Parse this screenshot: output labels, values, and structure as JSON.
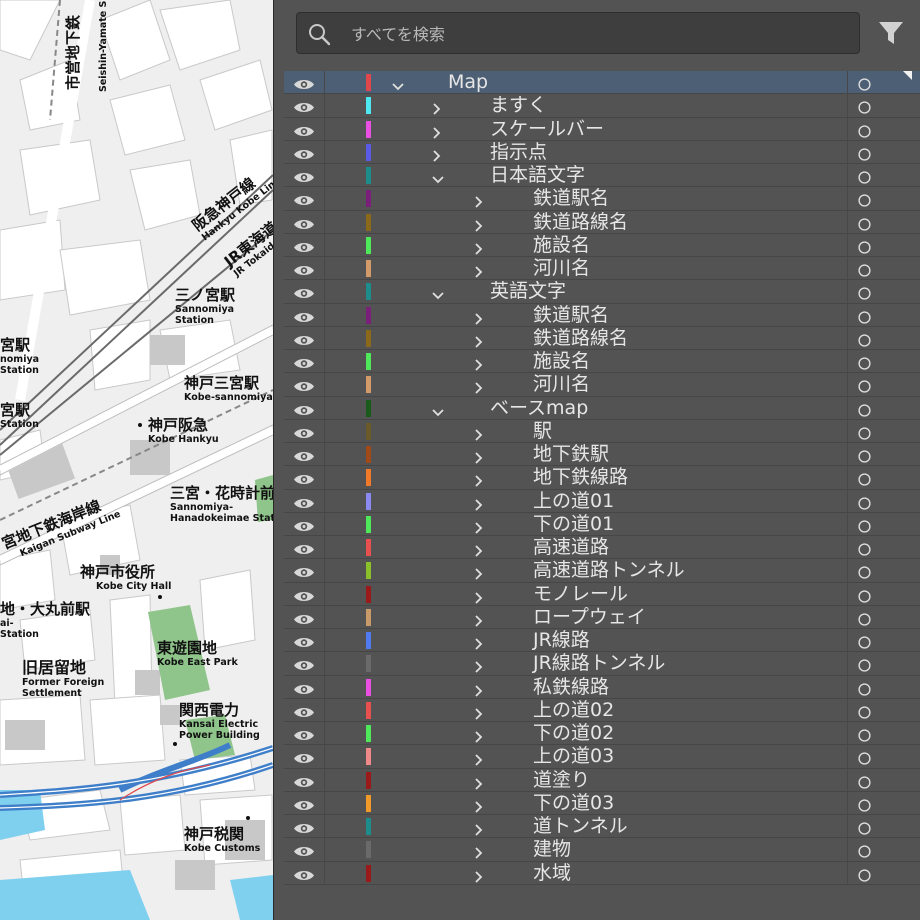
{
  "map": {
    "labels": [
      {
        "id": "seishin",
        "jp": "市営地下鉄",
        "en": "Seishin-Yamate Sub"
      },
      {
        "id": "hankyu",
        "jp": "阪急神戸線",
        "en": "Hankyu Kobe Line"
      },
      {
        "id": "jr-tokaido",
        "jp": "JR東海道",
        "en": "JR Tokaido"
      },
      {
        "id": "sannomiya-station",
        "jp": "三ノ宮駅",
        "en": "Sannomiya\nStation"
      },
      {
        "id": "miya-station-1",
        "jp": "宮駅",
        "en": "nomiya\nStation"
      },
      {
        "id": "kobe-sannomiya",
        "jp": "神戸三宮駅",
        "en": "Kobe-sannomiya"
      },
      {
        "id": "miya-station-2",
        "jp": "宮駅",
        "en": "Station"
      },
      {
        "id": "kobe-hankyu",
        "jp": "神戸阪急",
        "en": "Kobe Hankyu"
      },
      {
        "id": "kaigan-line",
        "jp": "宮地下鉄海岸線",
        "en": "Kaigan Subway Line"
      },
      {
        "id": "hanadokei",
        "jp": "三宮・花時計前",
        "en": "Sannomiya-\nHanadokeimae Stati"
      },
      {
        "id": "city-hall",
        "jp": "神戸市役所",
        "en": "Kobe City Hall"
      },
      {
        "id": "daimaru",
        "jp": "地・大丸前駅",
        "en": "ai-\nStation"
      },
      {
        "id": "east-park",
        "jp": "東遊園地",
        "en": "Kobe East Park"
      },
      {
        "id": "foreign-settlement",
        "jp": "旧居留地",
        "en": "Former Foreign\nSettlement"
      },
      {
        "id": "kansai-electric",
        "jp": "関西電力",
        "en": "Kansai Electric\nPower Building"
      },
      {
        "id": "customs",
        "jp": "神戸税関",
        "en": "Kobe Customs"
      }
    ]
  },
  "panel": {
    "search": {
      "placeholder": "すべてを検索"
    },
    "colors": {
      "background": "#535353",
      "selected": "#4d5f75",
      "text": "#e6e6e6"
    },
    "layers": [
      {
        "label": "Map",
        "level": 0,
        "expanded": true,
        "color": "#e0474c",
        "selected": true
      },
      {
        "label": "ますく",
        "level": 1,
        "expanded": false,
        "color": "#4fe8f0"
      },
      {
        "label": "スケールバー",
        "level": 1,
        "expanded": false,
        "color": "#e94fe0"
      },
      {
        "label": "指示点",
        "level": 1,
        "expanded": false,
        "color": "#5a5ae6"
      },
      {
        "label": "日本語文字",
        "level": 1,
        "expanded": true,
        "color": "#1f8c8c"
      },
      {
        "label": "鉄道駅名",
        "level": 2,
        "expanded": false,
        "color": "#7a1f7a"
      },
      {
        "label": "鉄道路線名",
        "level": 2,
        "expanded": false,
        "color": "#8a6a1a"
      },
      {
        "label": "施設名",
        "level": 2,
        "expanded": false,
        "color": "#4fe85a"
      },
      {
        "label": "河川名",
        "level": 2,
        "expanded": false,
        "color": "#d39a6a"
      },
      {
        "label": "英語文字",
        "level": 1,
        "expanded": true,
        "color": "#1f8c8c"
      },
      {
        "label": "鉄道駅名",
        "level": 2,
        "expanded": false,
        "color": "#7a1f7a"
      },
      {
        "label": "鉄道路線名",
        "level": 2,
        "expanded": false,
        "color": "#8a6a1a"
      },
      {
        "label": "施設名",
        "level": 2,
        "expanded": false,
        "color": "#4fe85a"
      },
      {
        "label": "河川名",
        "level": 2,
        "expanded": false,
        "color": "#d39a6a"
      },
      {
        "label": "ベースmap",
        "level": 1,
        "expanded": true,
        "color": "#1a5a1a"
      },
      {
        "label": "駅",
        "level": 2,
        "expanded": false,
        "color": "#6a5a2a"
      },
      {
        "label": "地下鉄駅",
        "level": 2,
        "expanded": false,
        "color": "#a04a1a"
      },
      {
        "label": "地下鉄線路",
        "level": 2,
        "expanded": false,
        "color": "#f07a2a"
      },
      {
        "label": "上の道01",
        "level": 2,
        "expanded": false,
        "color": "#8a8af0"
      },
      {
        "label": "下の道01",
        "level": 2,
        "expanded": false,
        "color": "#4fe85a"
      },
      {
        "label": "高速道路",
        "level": 2,
        "expanded": false,
        "color": "#e85050"
      },
      {
        "label": "高速道路トンネル",
        "level": 2,
        "expanded": false,
        "color": "#8ac02a"
      },
      {
        "label": "モノレール",
        "level": 2,
        "expanded": false,
        "color": "#9a1a1a"
      },
      {
        "label": "ロープウェイ",
        "level": 2,
        "expanded": false,
        "color": "#c89a6a"
      },
      {
        "label": "JR線路",
        "level": 2,
        "expanded": false,
        "color": "#4f7af0"
      },
      {
        "label": "JR線路トンネル",
        "level": 2,
        "expanded": false,
        "color": "#6a6a6a"
      },
      {
        "label": "私鉄線路",
        "level": 2,
        "expanded": false,
        "color": "#e94fe0"
      },
      {
        "label": "上の道02",
        "level": 2,
        "expanded": false,
        "color": "#e85050"
      },
      {
        "label": "下の道02",
        "level": 2,
        "expanded": false,
        "color": "#4fe85a"
      },
      {
        "label": "上の道03",
        "level": 2,
        "expanded": false,
        "color": "#f08a8a"
      },
      {
        "label": "道塗り",
        "level": 2,
        "expanded": false,
        "color": "#9a1a1a"
      },
      {
        "label": "下の道03",
        "level": 2,
        "expanded": false,
        "color": "#f09a2a"
      },
      {
        "label": "道トンネル",
        "level": 2,
        "expanded": false,
        "color": "#1f8c8c"
      },
      {
        "label": "建物",
        "level": 2,
        "expanded": false,
        "color": "#6a6a6a"
      },
      {
        "label": "水域",
        "level": 2,
        "expanded": false,
        "color": "#9a1a1a"
      }
    ]
  }
}
